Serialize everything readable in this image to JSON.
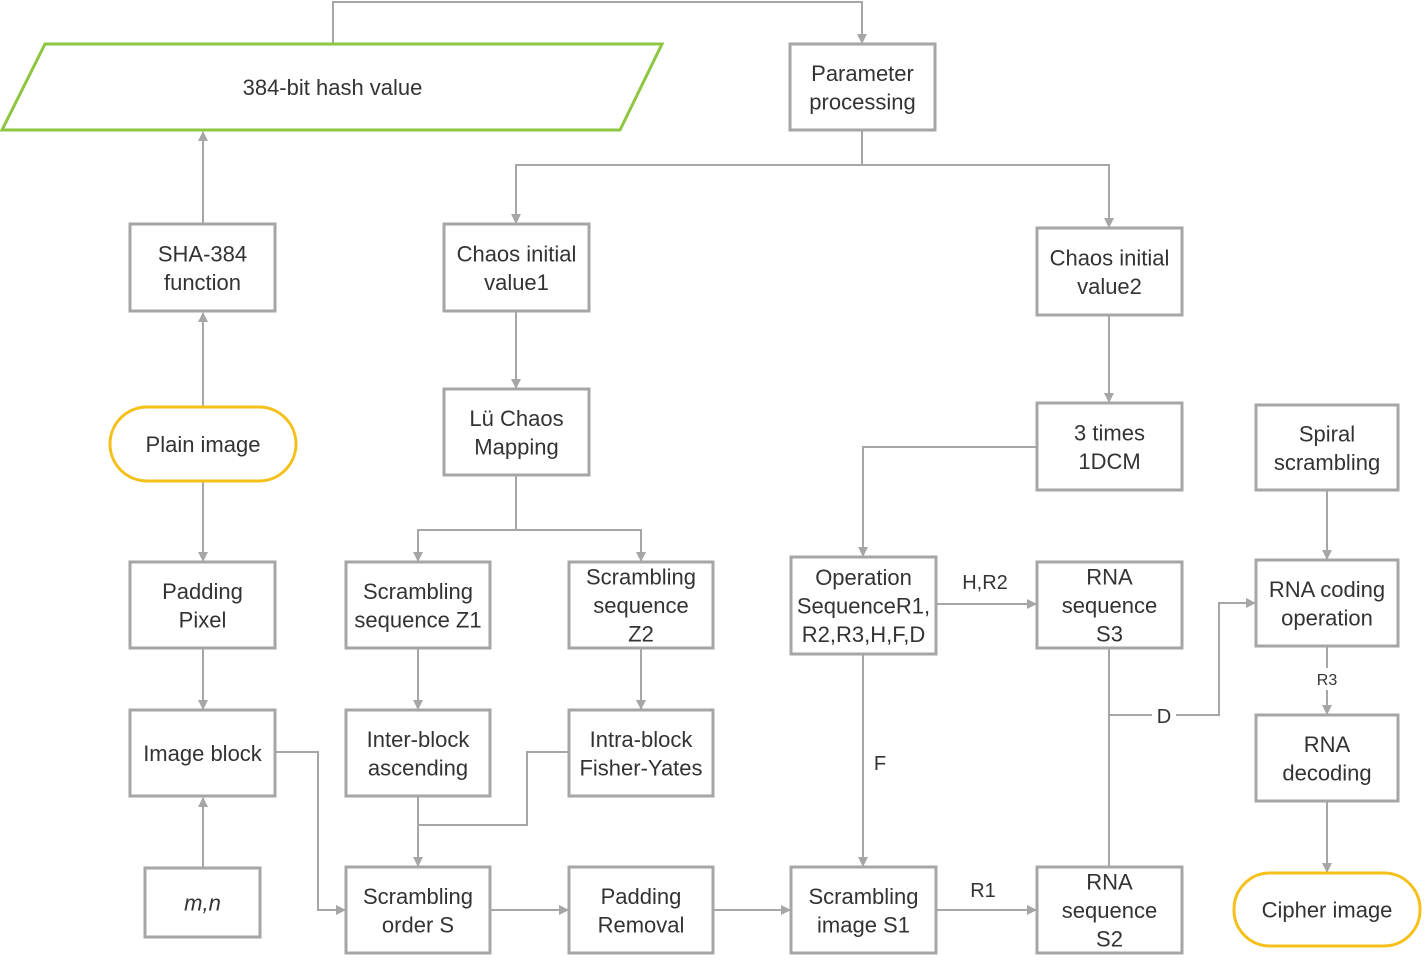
{
  "colors": {
    "box_border": "#a6a6a6",
    "hash_border": "#8dc63f",
    "terminal_border": "#f5c01a",
    "connector": "#a6a6a6"
  },
  "nodes": {
    "hash": [
      "384-bit hash value"
    ],
    "param": [
      "Parameter",
      "processing"
    ],
    "sha": [
      "SHA-384",
      "function"
    ],
    "chaos1": [
      "Chaos initial",
      "value1"
    ],
    "chaos2": [
      "Chaos initial",
      "value2"
    ],
    "plain": [
      "Plain image"
    ],
    "lu": [
      "Lü Chaos",
      "Mapping"
    ],
    "dcm": [
      "3 times",
      "1DCM"
    ],
    "spiral": [
      "Spiral",
      "scrambling"
    ],
    "padding": [
      "Padding",
      "Pixel"
    ],
    "z1": [
      "Scrambling",
      "sequence Z1"
    ],
    "z2": [
      "Scrambling",
      "sequence",
      "Z2"
    ],
    "op": [
      "Operation",
      "SequenceR1,",
      "R2,R3,H,F,D"
    ],
    "s3": [
      "RNA",
      "sequence",
      "S3"
    ],
    "coding": [
      "RNA coding",
      "operation"
    ],
    "block": [
      "Image block"
    ],
    "inter": [
      "Inter-block",
      "ascending"
    ],
    "intra": [
      "Intra-block",
      "Fisher-Yates"
    ],
    "decoding": [
      "RNA",
      "decoding"
    ],
    "mn": [
      "m,n"
    ],
    "order": [
      "Scrambling",
      "order S"
    ],
    "removal": [
      "Padding",
      "Removal"
    ],
    "s1": [
      "Scrambling",
      "image S1"
    ],
    "s2": [
      "RNA",
      "sequence",
      "S2"
    ],
    "cipher": [
      "Cipher image"
    ]
  },
  "edge_labels": {
    "hr2": "H,R2",
    "f": "F",
    "d": "D",
    "r3": "R3",
    "r1": "R1"
  }
}
